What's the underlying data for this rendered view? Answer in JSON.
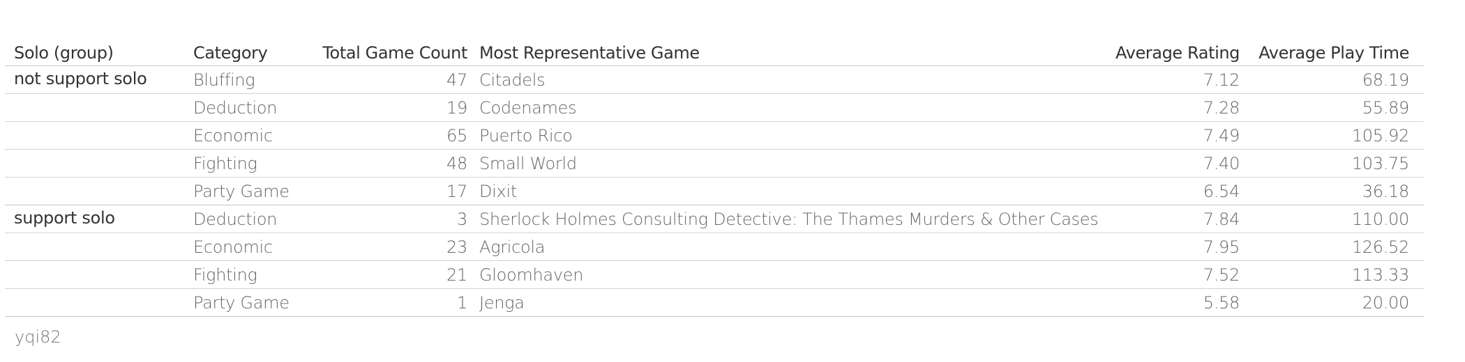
{
  "chart_data": {
    "type": "table",
    "columns": [
      "Solo (group)",
      "Category",
      "Total Game Count",
      "Most Representative Game",
      "Average Rating",
      "Average Play Time"
    ],
    "groups": [
      {
        "name": "not support solo",
        "rows": [
          {
            "category": "Bluffing",
            "count": "47",
            "game": "Citadels",
            "rating": "7.12",
            "time": "68.19"
          },
          {
            "category": "Deduction",
            "count": "19",
            "game": "Codenames",
            "rating": "7.28",
            "time": "55.89"
          },
          {
            "category": "Economic",
            "count": "65",
            "game": "Puerto Rico",
            "rating": "7.49",
            "time": "105.92"
          },
          {
            "category": "Fighting",
            "count": "48",
            "game": "Small World",
            "rating": "7.40",
            "time": "103.75"
          },
          {
            "category": "Party Game",
            "count": "17",
            "game": "Dixit",
            "rating": "6.54",
            "time": "36.18"
          }
        ]
      },
      {
        "name": "support solo",
        "rows": [
          {
            "category": "Deduction",
            "count": "3",
            "game": "Sherlock Holmes Consulting Detective: The Thames Murders & Other Cases",
            "rating": "7.84",
            "time": "110.00"
          },
          {
            "category": "Economic",
            "count": "23",
            "game": "Agricola",
            "rating": "7.95",
            "time": "126.52"
          },
          {
            "category": "Fighting",
            "count": "21",
            "game": "Gloomhaven",
            "rating": "7.52",
            "time": "113.33"
          },
          {
            "category": "Party Game",
            "count": "1",
            "game": "Jenga",
            "rating": "5.58",
            "time": "20.00"
          }
        ]
      }
    ]
  },
  "footer": "yqi82"
}
